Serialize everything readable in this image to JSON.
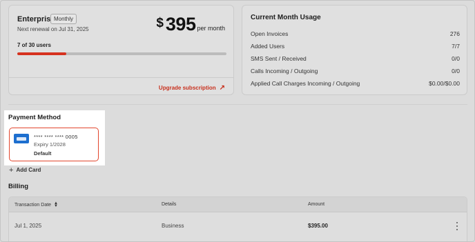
{
  "plan": {
    "name": "Enterprise",
    "badge": "Monthly",
    "renewal": "Next renewal on Jul 31, 2025",
    "currency_symbol": "$",
    "price": "395",
    "period": "per month",
    "users": "7 of 30 users",
    "users_used": 7,
    "users_total": 30,
    "upgrade_label": "Upgrade subscription",
    "progress_color": "#d6321f"
  },
  "usage": {
    "title": "Current Month Usage",
    "rows": [
      {
        "label": "Open Invoices",
        "value": "276"
      },
      {
        "label": "Added Users",
        "value": "7/7"
      },
      {
        "label": "SMS Sent / Received",
        "value": "0/0"
      },
      {
        "label": "Calls Incoming / Outgoing",
        "value": "0/0"
      },
      {
        "label": "Applied Call Charges Incoming / Outgoing",
        "value": "$0.00/$0.00"
      }
    ]
  },
  "payment": {
    "title": "Payment Method",
    "card": {
      "number": "**** **** **** 0005",
      "expiry": "Expiry 1/2028",
      "status": "Default",
      "brand_icon": "amex-card-icon",
      "brand_color": "#1d6fcf"
    },
    "add_card_label": "Add Card"
  },
  "billing": {
    "title": "Billing",
    "columns": [
      "Transaction Date",
      "Details",
      "Amount"
    ],
    "rows": [
      {
        "date": "Jul 1, 2025",
        "details": "Business",
        "amount": "$395.00"
      }
    ]
  }
}
